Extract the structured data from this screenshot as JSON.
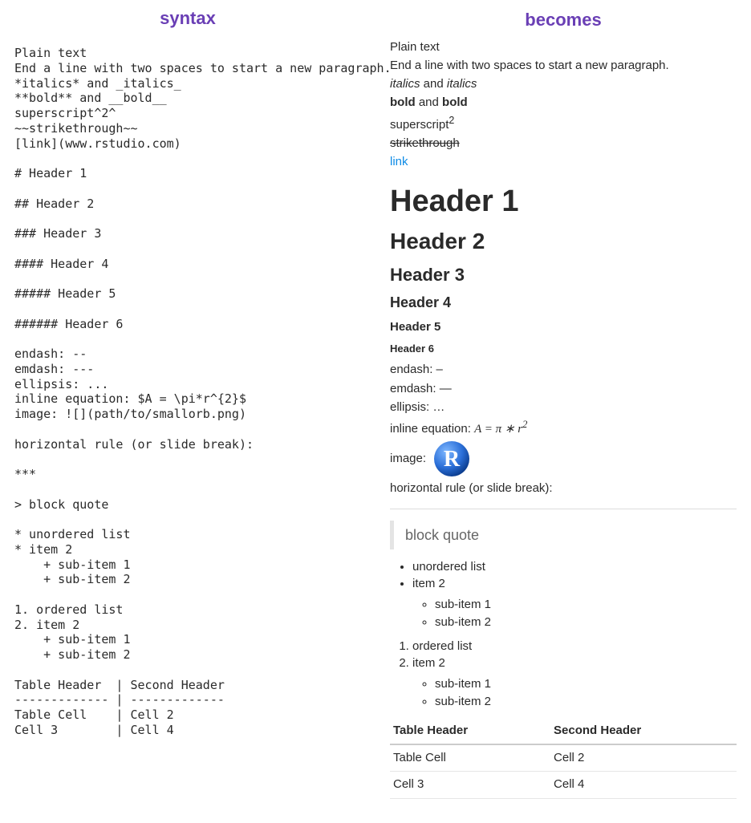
{
  "titles": {
    "left": "syntax",
    "right": "becomes"
  },
  "syntax_lines": [
    "Plain text",
    "End a line with two spaces to start a new paragraph.",
    "*italics* and _italics_",
    "**bold** and __bold__",
    "superscript^2^",
    "~~strikethrough~~",
    "[link](www.rstudio.com)",
    "",
    "# Header 1",
    "",
    "## Header 2",
    "",
    "### Header 3",
    "",
    "#### Header 4",
    "",
    "##### Header 5",
    "",
    "###### Header 6",
    "",
    "endash: --",
    "emdash: ---",
    "ellipsis: ...",
    "inline equation: $A = \\pi*r^{2}$",
    "image: ![](path/to/smallorb.png)",
    "",
    "horizontal rule (or slide break):",
    "",
    "***",
    "",
    "> block quote",
    "",
    "* unordered list",
    "* item 2",
    "    + sub-item 1",
    "    + sub-item 2",
    "",
    "1. ordered list",
    "2. item 2",
    "    + sub-item 1",
    "    + sub-item 2",
    "",
    "Table Header  | Second Header",
    "------------- | -------------",
    "Table Cell    | Cell 2",
    "Cell 3        | Cell 4"
  ],
  "rendered": {
    "plain1": "Plain text",
    "plain2": "End a line with two spaces to start a new paragraph.",
    "italics_word": "italics",
    "and": " and ",
    "bold_word": "bold",
    "superscript_label": "superscript",
    "superscript_exp": "2",
    "strikethrough": "strikethrough",
    "link_text": "link",
    "h1": "Header 1",
    "h2": "Header 2",
    "h3": "Header 3",
    "h4": "Header 4",
    "h5": "Header 5",
    "h6": "Header 6",
    "endash": "endash: –",
    "emdash": "emdash: —",
    "ellipsis": "ellipsis: …",
    "eq_label": "inline equation: ",
    "eq_A": "A",
    "eq_eqpi": " = π ∗ ",
    "eq_r": "r",
    "eq_exp": "2",
    "image_label": "image: ",
    "hr_label": "horizontal rule (or slide break):",
    "blockquote": "block quote",
    "ul1": "unordered list",
    "ul2": "item 2",
    "ul_sub1": "sub-item 1",
    "ul_sub2": "sub-item 2",
    "ol1": "ordered list",
    "ol2": "item 2",
    "ol_sub1": "sub-item 1",
    "ol_sub2": "sub-item 2",
    "table": {
      "headers": [
        "Table Header",
        "Second Header"
      ],
      "rows": [
        [
          "Table Cell",
          "Cell 2"
        ],
        [
          "Cell 3",
          "Cell 4"
        ]
      ]
    }
  }
}
